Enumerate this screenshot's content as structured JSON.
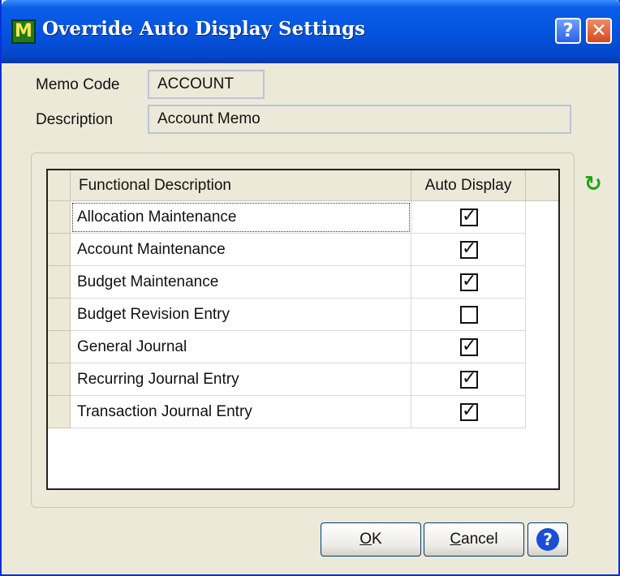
{
  "window": {
    "title": "Override Auto Display Settings",
    "app_icon_glyph": "M",
    "help_glyph": "?",
    "close_glyph": "✕"
  },
  "form": {
    "memo_code_label": "Memo Code",
    "memo_code_value": "ACCOUNT",
    "description_label": "Description",
    "description_value": "Account Memo"
  },
  "grid": {
    "columns": [
      "Functional Description",
      "Auto Display"
    ],
    "rows": [
      {
        "description": "Allocation Maintenance",
        "auto_display": true
      },
      {
        "description": "Account Maintenance",
        "auto_display": true
      },
      {
        "description": "Budget Maintenance",
        "auto_display": true
      },
      {
        "description": "Budget Revision Entry",
        "auto_display": false
      },
      {
        "description": "General Journal",
        "auto_display": true
      },
      {
        "description": "Recurring Journal Entry",
        "auto_display": true
      },
      {
        "description": "Transaction Journal Entry",
        "auto_display": true
      }
    ]
  },
  "buttons": {
    "ok_mnemonic": "O",
    "ok_rest": "K",
    "cancel_mnemonic": "C",
    "cancel_rest": "ancel",
    "help_glyph": "?"
  },
  "icons": {
    "refresh": "refresh-icon",
    "checkmark_glyph": "✓"
  },
  "colors": {
    "title_bar": "#0554e0",
    "close_button": "#d64a1e",
    "dialog_face": "#ece9d8",
    "refresh_icon": "#1aa51a"
  }
}
